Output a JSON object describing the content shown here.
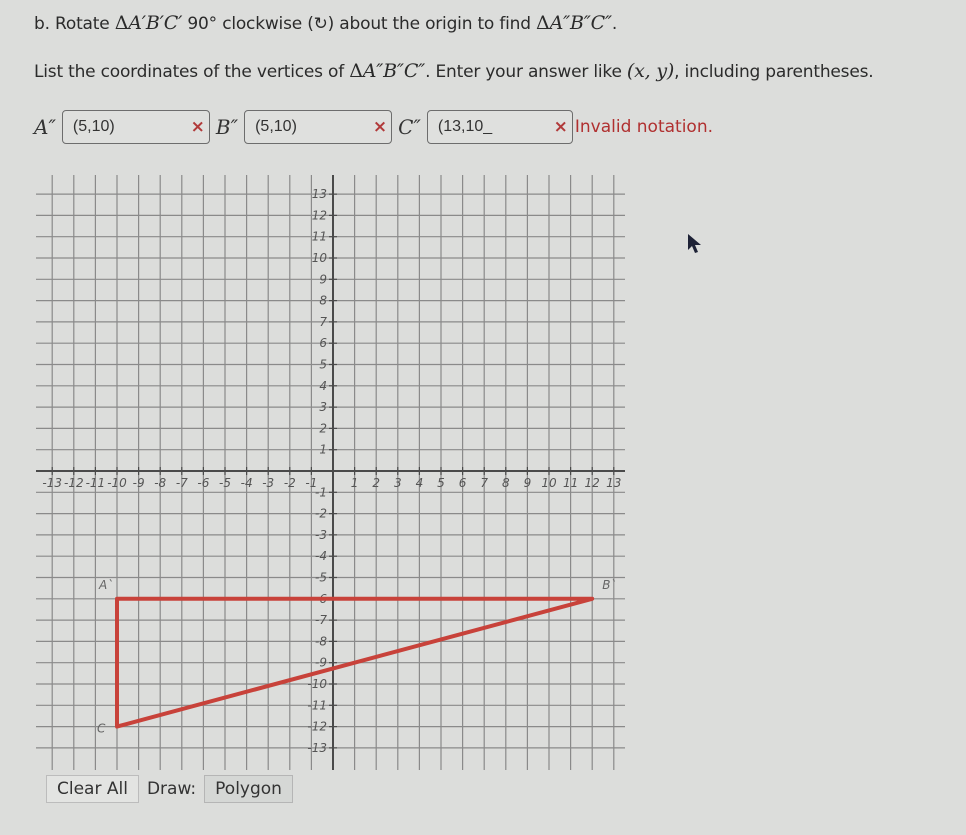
{
  "question": {
    "part": "b.",
    "rotate_word": "Rotate",
    "source_triangle": "A′B′C′",
    "angle": "90°",
    "direction_text": "clockwise (↻) about the origin to find",
    "target_triangle": "A″B″C″",
    "instruction_prefix": "List the coordinates of the vertices of",
    "instruction_mid": ". Enter your answer like",
    "format_example": "(x, y)",
    "instruction_suffix": ", including parentheses."
  },
  "answers": [
    {
      "label": "A″",
      "value": "(5,10)",
      "clear_icon": "×"
    },
    {
      "label": "B″",
      "value": "(5,10)",
      "clear_icon": "×"
    },
    {
      "label": "C″",
      "value": "(13,10_",
      "clear_icon": "×",
      "error": "Invalid notation."
    }
  ],
  "colors": {
    "polygon": "#c8423a",
    "error": "#b03030",
    "grid": "#8a8a8a",
    "axis": "#4a4a4a"
  },
  "chart_data": {
    "type": "coordinate-grid",
    "x_range": [
      -13,
      13
    ],
    "y_range": [
      -13,
      13
    ],
    "x_ticks": [
      -13,
      -12,
      -11,
      -10,
      -9,
      -8,
      -7,
      -6,
      -5,
      -4,
      -3,
      -2,
      -1,
      1,
      2,
      3,
      4,
      5,
      6,
      7,
      8,
      9,
      10,
      11,
      12,
      13
    ],
    "y_ticks": [
      13,
      12,
      11,
      10,
      9,
      8,
      7,
      6,
      5,
      4,
      3,
      2,
      1,
      -1,
      -2,
      -3,
      -4,
      -5,
      -6,
      -7,
      -8,
      -9,
      -10,
      -11,
      -12,
      -13
    ],
    "grid": true,
    "polygon": {
      "name": "triangle A′B′C′",
      "vertices": [
        {
          "label": "A`",
          "x": -10,
          "y": -6
        },
        {
          "label": "B`",
          "x": 12,
          "y": -6
        },
        {
          "label": "C",
          "x": -10,
          "y": -12
        }
      ]
    }
  },
  "toolbar": {
    "clear_label": "Clear All",
    "draw_label": "Draw:",
    "polygon_label": "Polygon"
  }
}
